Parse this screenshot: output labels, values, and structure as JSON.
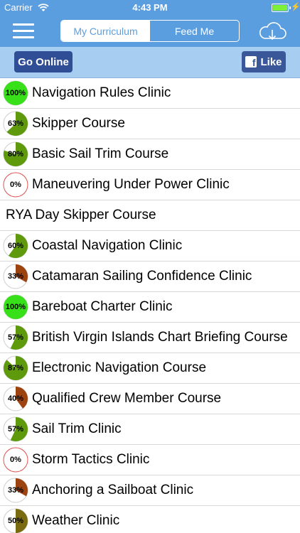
{
  "status_bar": {
    "carrier": "Carrier",
    "time": "4:43 PM"
  },
  "nav": {
    "segments": [
      "My Curriculum",
      "Feed Me"
    ],
    "selected_segment": "My Curriculum"
  },
  "toolbar": {
    "go_online_label": "Go Online",
    "like_label": "Like"
  },
  "colors": {
    "nav_blue": "#5b9ee0",
    "toolbar_blue": "#a7cdf1",
    "button_navy": "#2f4e96",
    "facebook_blue": "#3a5899",
    "progress_full": "#38e01a",
    "progress_partial_green": "#5e9a0c",
    "progress_partial_brown": "#9c4310",
    "progress_partial_olive": "#7b6b10"
  },
  "courses": [
    {
      "title": "Navigation Rules Clinic",
      "progress": 100,
      "percent_label": "100%"
    },
    {
      "title": "Skipper Course",
      "progress": 63,
      "percent_label": "63%"
    },
    {
      "title": "Basic Sail Trim Course",
      "progress": 80,
      "percent_label": "80%"
    },
    {
      "title": "Maneuvering Under Power Clinic",
      "progress": 0,
      "percent_label": "0%"
    },
    {
      "title": "RYA Day Skipper Course",
      "is_header": true
    },
    {
      "title": "Coastal Navigation Clinic",
      "progress": 60,
      "percent_label": "60%"
    },
    {
      "title": "Catamaran Sailing Confidence Clinic",
      "progress": 33,
      "percent_label": "33%"
    },
    {
      "title": "Bareboat Charter Clinic",
      "progress": 100,
      "percent_label": "100%"
    },
    {
      "title": "British Virgin Islands Chart Briefing Course",
      "progress": 57,
      "percent_label": "57%"
    },
    {
      "title": "Electronic Navigation Course",
      "progress": 87,
      "percent_label": "87%"
    },
    {
      "title": "Qualified Crew Member Course",
      "progress": 40,
      "percent_label": "40%"
    },
    {
      "title": "Sail Trim Clinic",
      "progress": 57,
      "percent_label": "57%"
    },
    {
      "title": "Storm Tactics Clinic",
      "progress": 0,
      "percent_label": "0%"
    },
    {
      "title": "Anchoring a Sailboat Clinic",
      "progress": 33,
      "percent_label": "33%"
    },
    {
      "title": "Weather Clinic",
      "progress": 50,
      "percent_label": "50%"
    }
  ]
}
